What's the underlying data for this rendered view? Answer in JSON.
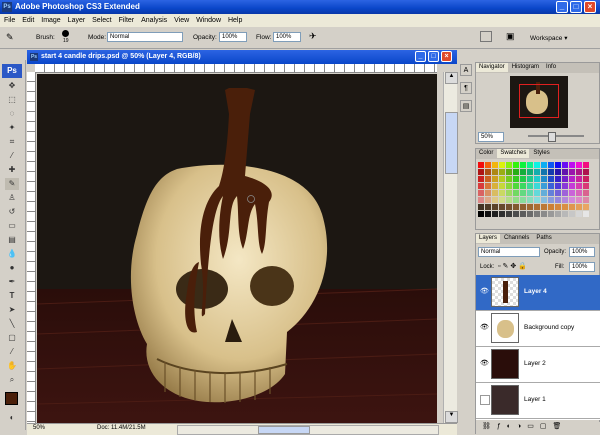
{
  "app": {
    "title": "Adobe Photoshop CS3 Extended",
    "logo": "Ps"
  },
  "menu": [
    "File",
    "Edit",
    "Image",
    "Layer",
    "Select",
    "Filter",
    "Analysis",
    "View",
    "Window",
    "Help"
  ],
  "options": {
    "brush_label": "Brush:",
    "brush_size": "19",
    "mode_label": "Mode:",
    "mode_value": "Normal",
    "opacity_label": "Opacity:",
    "opacity_value": "100%",
    "flow_label": "Flow:",
    "flow_value": "100%",
    "workspace_label": "Workspace ▾"
  },
  "document": {
    "title": "start 4 candle drips.psd @ 50% (Layer 4, RGB/8)",
    "zoom": "50%",
    "doc_info": "Doc: 11.4M/21.5M"
  },
  "navigator": {
    "tabs": [
      "Navigator",
      "Histogram",
      "Info"
    ],
    "zoom": "50%"
  },
  "swatches_panel": {
    "tabs": [
      "Color",
      "Swatches",
      "Styles"
    ]
  },
  "layers_panel": {
    "tabs": [
      "Layers",
      "Channels",
      "Paths"
    ],
    "blend_mode": "Normal",
    "opacity_label": "Opacity:",
    "opacity_value": "100%",
    "lock_label": "Lock:",
    "fill_label": "Fill:",
    "fill_value": "100%",
    "layers": [
      {
        "name": "Layer 4"
      },
      {
        "name": "Background copy"
      },
      {
        "name": "Layer 2"
      },
      {
        "name": "Layer 1"
      }
    ]
  },
  "colors": {
    "accent": "#3169c6",
    "title_bar": "#0a46c9",
    "wax": "#4a1f0a",
    "canvas_bg": "#1c1712"
  }
}
